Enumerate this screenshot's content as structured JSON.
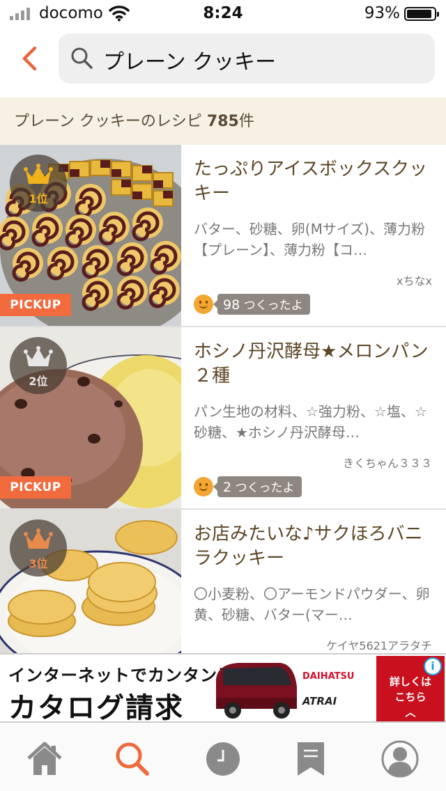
{
  "status_bar": {
    "carrier": "docomo",
    "time": "8:24",
    "battery": "93%",
    "battery_level": 0.93
  },
  "search": {
    "query": "プレーン クッキー"
  },
  "result_header": {
    "text": "プレーン クッキーのレシピ ",
    "count": "785",
    "unit": "件"
  },
  "recipes": [
    {
      "title": "たっぷりアイスボックスクッキー",
      "ingredients": "バター、砂糖、卵(Mサイズ)、薄力粉【プレーン】、薄力粉【コ…",
      "author": "xちなx",
      "rank": "1位",
      "pickup": "PICKUP",
      "tsukurepo_count": "98",
      "tsukurepo_label": " つくったよ"
    },
    {
      "title": "ホシノ丹沢酵母★メロンパン２種",
      "ingredients": "パン生地の材料、☆強力粉、☆塩、☆砂糖、★ホシノ丹沢酵母…",
      "author": "きくちゃん３３３",
      "rank": "2位",
      "pickup": "PICKUP",
      "tsukurepo_count": "2",
      "tsukurepo_label": " つくったよ"
    },
    {
      "title": "お店みたいな♪サクほろバニラクッキー",
      "ingredients": "〇小麦粉、〇アーモンドパウダー、卵黄、砂糖、バター(マー…",
      "author": "ケイヤ5621アラタチ",
      "rank": "3位"
    }
  ],
  "ad": {
    "line1": "インターネットでカンタンに。",
    "line2": "カタログ請求",
    "brand1": "DAIHATSU",
    "brand2": "ATRAI",
    "cta_line1": "詳しくは",
    "cta_line2": "こちら",
    "cta_arrow": "︿",
    "info": "i"
  },
  "colors": {
    "accent": "#f16b3f",
    "gold": "#f2b21c",
    "silver": "#e6e6e6",
    "bronze": "#e88a4a"
  },
  "tabs": [
    "home-icon",
    "search-icon",
    "history-icon",
    "bookmark-icon",
    "profile-icon"
  ]
}
